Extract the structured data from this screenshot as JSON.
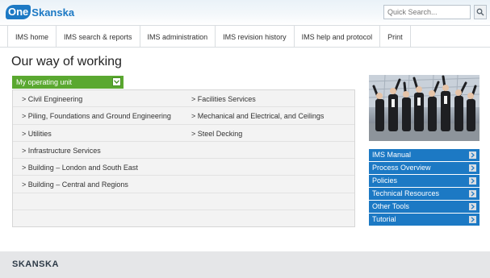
{
  "header": {
    "logo_one": "One",
    "logo_rest": "Skanska",
    "search_placeholder": "Quick Search..."
  },
  "nav": [
    "IMS home",
    "IMS search & reports",
    "IMS administration",
    "IMS revision history",
    "IMS help and protocol",
    "Print"
  ],
  "page_title": "Our way of working",
  "unit": {
    "header": "My operating unit",
    "rows": [
      [
        "> Civil Engineering",
        "> Facilities Services"
      ],
      [
        "> Piling, Foundations and Ground Engineering",
        "> Mechanical and Electrical, and Ceilings"
      ],
      [
        "> Utilities",
        "> Steel Decking"
      ],
      [
        "> Infrastructure Services",
        ""
      ],
      [
        "> Building – London and South East",
        ""
      ],
      [
        "> Building – Central and Regions",
        ""
      ],
      [
        "",
        ""
      ],
      [
        "",
        ""
      ]
    ]
  },
  "side_menu": [
    "IMS Manual",
    "Process Overview",
    "Policies",
    "Technical Resources",
    "Other Tools",
    "Tutorial"
  ],
  "footer": {
    "logo": "SKANSKA"
  },
  "colors": {
    "brand_blue": "#1c79c4",
    "unit_green": "#5aa830"
  }
}
